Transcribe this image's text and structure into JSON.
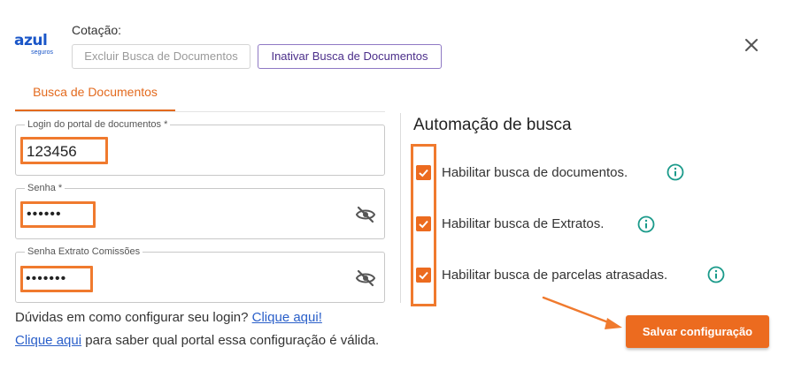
{
  "header": {
    "logo_text": "azul",
    "logo_sub": "seguros",
    "cotacao_label": "Cotação:",
    "excluir_label": "Excluir Busca de Documentos",
    "inativar_label": "Inativar Busca de Documentos",
    "close_icon": "close-icon"
  },
  "tabs": [
    {
      "label": "Busca de Documentos",
      "active": true
    }
  ],
  "form": {
    "login": {
      "label": "Login do portal de documentos *",
      "value": "123456"
    },
    "senha": {
      "label": "Senha *",
      "value": "••••••",
      "icon": "eye-slash-icon"
    },
    "senha_extrato": {
      "label": "Senha Extrato Comissões",
      "value": "•••••••",
      "icon": "eye-slash-icon"
    }
  },
  "automacao": {
    "title": "Automação de busca",
    "options": [
      {
        "label": "Habilitar busca de documentos.",
        "checked": true,
        "icon": "info-icon"
      },
      {
        "label": "Habilitar busca de Extratos.",
        "checked": true,
        "icon": "info-icon"
      },
      {
        "label": "Habilitar busca de parcelas atrasadas.",
        "checked": true,
        "icon": "info-icon"
      }
    ]
  },
  "help": {
    "line1_text": "Dúvidas em como configurar seu login? ",
    "line1_link": "Clique aqui!",
    "line2_link": "Clique aqui",
    "line2_text": " para saber qual portal essa configuração é válida."
  },
  "actions": {
    "save_label": "Salvar configuração"
  },
  "colors": {
    "accent": "#ec6b1f",
    "highlight": "#f07a2e",
    "link": "#2a5fc9",
    "inativar": "#4b2e8a",
    "info": "#1a9a8a",
    "brand": "#1a56c8"
  }
}
